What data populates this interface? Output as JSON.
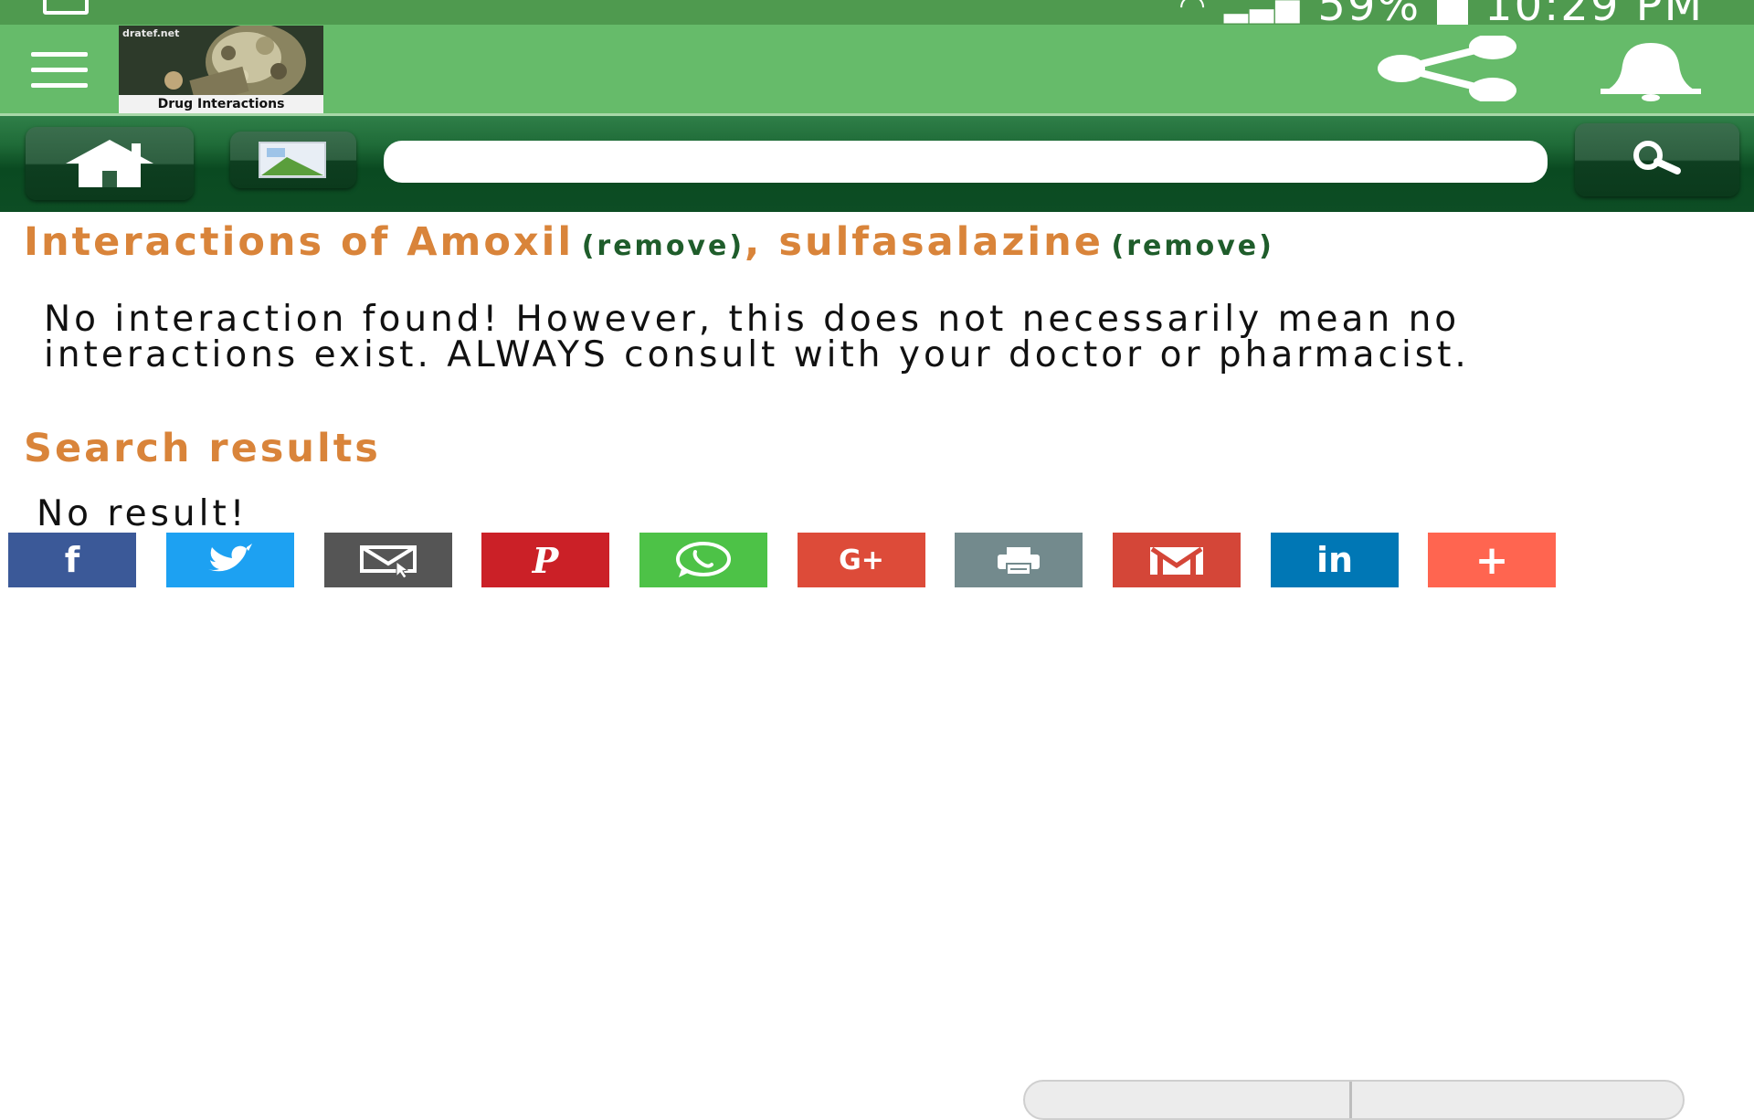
{
  "status_bar": {
    "battery": "59%",
    "time": "10:29 PM"
  },
  "app_bar": {
    "logo": {
      "site": "dratef.net",
      "label": "Drug Interactions"
    }
  },
  "search": {
    "placeholder": "",
    "value": ""
  },
  "heading": {
    "prefix": "Interactions of ",
    "drug1": "Amoxil",
    "remove1": "(remove)",
    "separator": ", ",
    "drug2": "sulfasalazine",
    "remove2": "(remove)"
  },
  "message": "No interaction found! However, this does not necessarily mean no interactions exist. ALWAYS consult with your doctor or pharmacist.",
  "search_results": {
    "title": "Search results",
    "empty_text": "No result!"
  },
  "share_buttons": [
    {
      "name": "facebook",
      "color": "#3b5998"
    },
    {
      "name": "twitter",
      "color": "#1da1f2"
    },
    {
      "name": "email",
      "color": "#555555"
    },
    {
      "name": "pinterest",
      "color": "#cb2027"
    },
    {
      "name": "whatsapp",
      "color": "#4dc247"
    },
    {
      "name": "google-plus",
      "color": "#dd4b39"
    },
    {
      "name": "print",
      "color": "#738a8d"
    },
    {
      "name": "gmail",
      "color": "#d44638"
    },
    {
      "name": "linkedin",
      "color": "#0077b5"
    },
    {
      "name": "more",
      "color": "#ff6550"
    }
  ]
}
